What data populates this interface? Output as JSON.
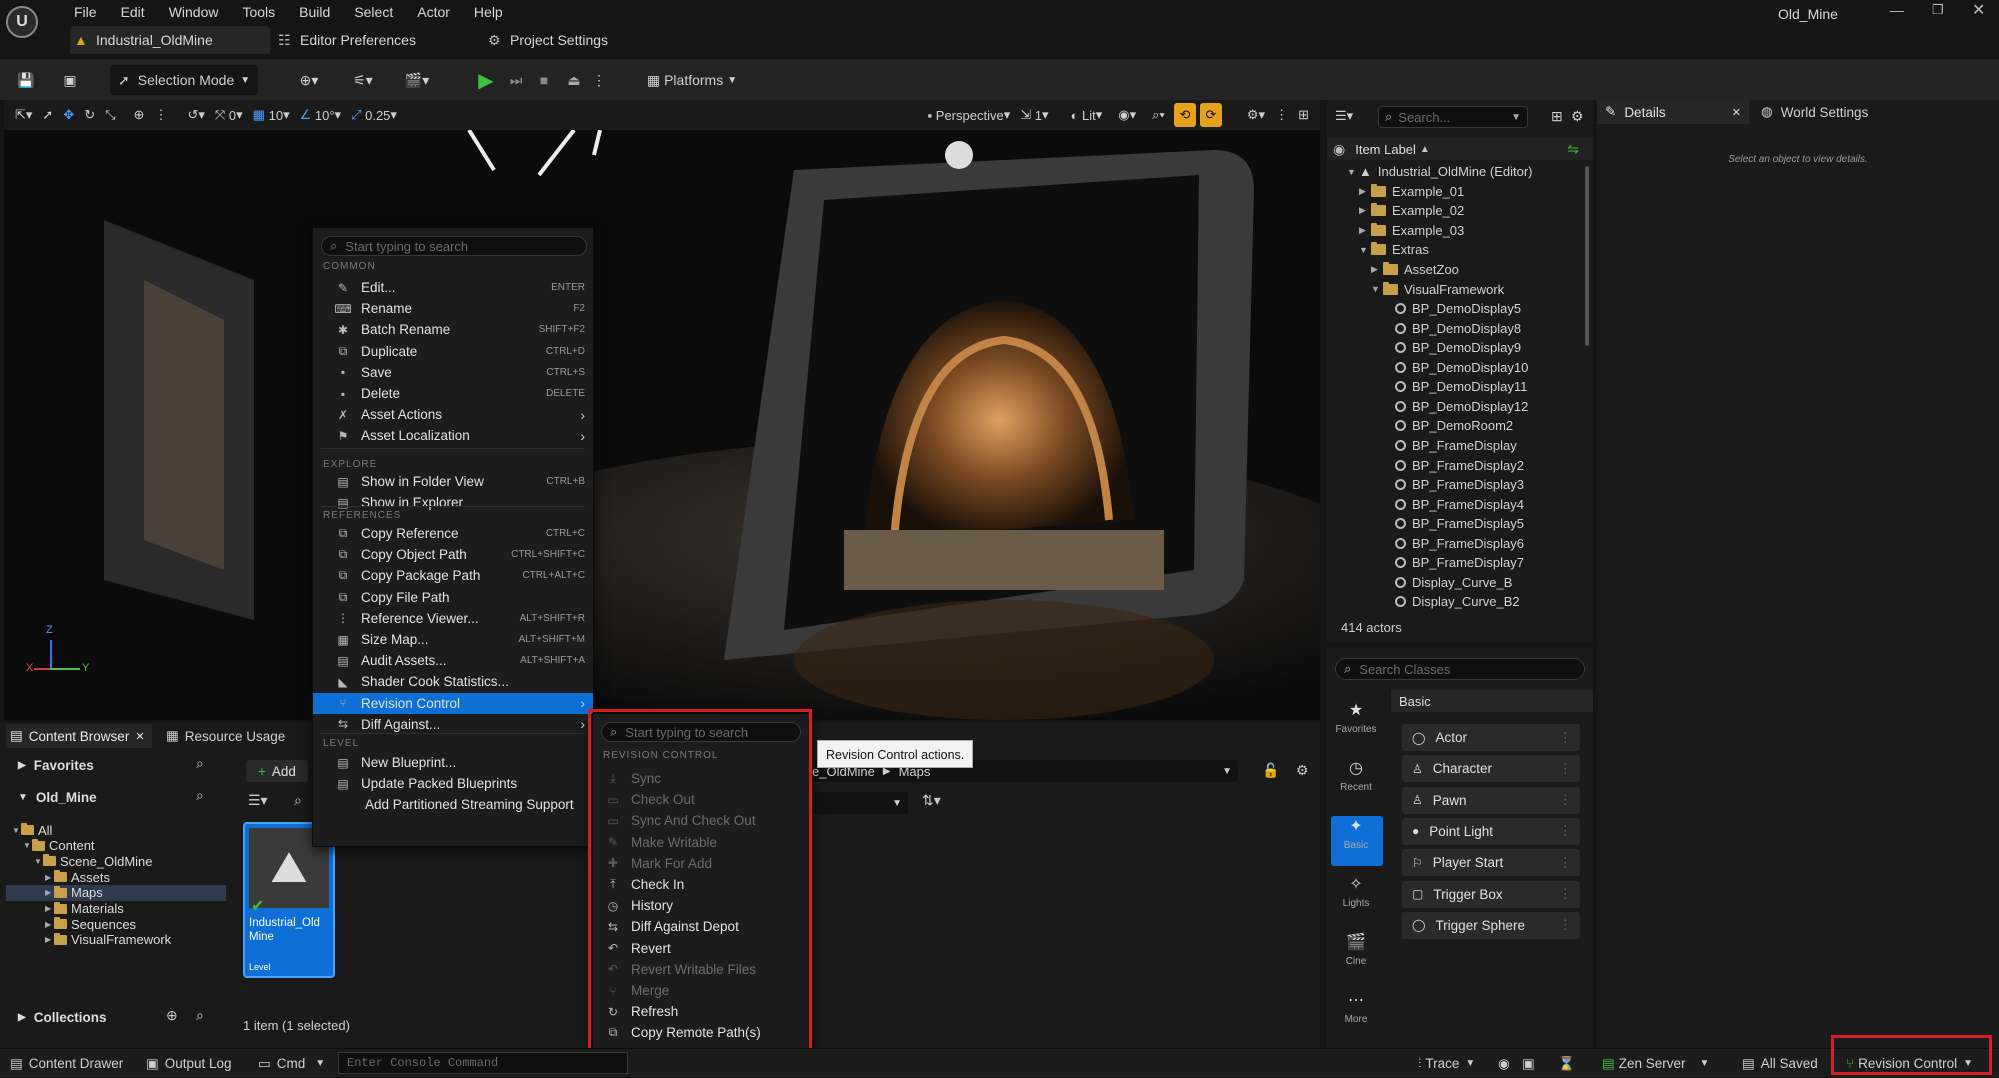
{
  "app": {
    "window_title": "Old_Mine",
    "menu": [
      "File",
      "Edit",
      "Window",
      "Tools",
      "Build",
      "Select",
      "Actor",
      "Help"
    ],
    "tabs": [
      {
        "label": "Industrial_OldMine",
        "active": true
      },
      {
        "label": "Editor Preferences"
      },
      {
        "label": "Project Settings"
      }
    ]
  },
  "toolbar": {
    "selection_mode": "Selection Mode",
    "platforms": "Platforms"
  },
  "viewport": {
    "snap_rotation": "0",
    "grid_size": "10",
    "rotation_snap": "10°",
    "scale_snap": "0.25",
    "view_mode_perspective": "Perspective",
    "camera_speed": "1",
    "lit": "Lit",
    "axis_z": "Z",
    "axis_x": "X",
    "axis_y": "Y"
  },
  "context_menu": {
    "search_placeholder": "Start typing to search",
    "sections": {
      "common": "COMMON",
      "explore": "EXPLORE",
      "references": "REFERENCES",
      "level": "LEVEL"
    },
    "common": [
      {
        "label": "Edit...",
        "shortcut": "ENTER",
        "icon": "pencil-icon"
      },
      {
        "label": "Rename",
        "shortcut": "F2",
        "icon": "rename-icon"
      },
      {
        "label": "Batch Rename",
        "shortcut": "SHIFT+F2",
        "icon": "batch-rename-icon"
      },
      {
        "label": "Duplicate",
        "shortcut": "CTRL+D",
        "icon": "duplicate-icon"
      },
      {
        "label": "Save",
        "shortcut": "CTRL+S",
        "icon": "save-icon"
      },
      {
        "label": "Delete",
        "shortcut": "DELETE",
        "icon": "trash-icon"
      },
      {
        "label": "Asset Actions",
        "submenu": true,
        "icon": "wrench-icon"
      },
      {
        "label": "Asset Localization",
        "submenu": true,
        "icon": "flag-icon"
      }
    ],
    "explore": [
      {
        "label": "Show in Folder View",
        "shortcut": "CTRL+B",
        "icon": "folder-view-icon"
      },
      {
        "label": "Show in Explorer",
        "icon": "explorer-icon"
      }
    ],
    "references": [
      {
        "label": "Copy Reference",
        "shortcut": "CTRL+C",
        "icon": "copy-icon"
      },
      {
        "label": "Copy Object Path",
        "shortcut": "CTRL+SHIFT+C",
        "icon": "copy-icon"
      },
      {
        "label": "Copy Package Path",
        "shortcut": "CTRL+ALT+C",
        "icon": "copy-icon"
      },
      {
        "label": "Copy File Path",
        "icon": "copy-icon"
      },
      {
        "label": "Reference Viewer...",
        "shortcut": "ALT+SHIFT+R",
        "icon": "reference-viewer-icon"
      },
      {
        "label": "Size Map...",
        "shortcut": "ALT+SHIFT+M",
        "icon": "size-map-icon"
      },
      {
        "label": "Audit Assets...",
        "shortcut": "ALT+SHIFT+A",
        "icon": "audit-icon"
      },
      {
        "label": "Shader Cook Statistics...",
        "icon": "shader-icon"
      },
      {
        "label": "Revision Control",
        "submenu": true,
        "highlighted": true,
        "icon": "revision-control-icon"
      },
      {
        "label": "Diff Against...",
        "submenu": true,
        "icon": "diff-icon"
      }
    ],
    "level": [
      {
        "label": "New Blueprint...",
        "icon": "blueprint-icon"
      },
      {
        "label": "Update Packed Blueprints",
        "icon": "blueprint-icon"
      },
      {
        "label": "Add Partitioned Streaming Support"
      }
    ]
  },
  "revision_submenu": {
    "search_placeholder": "Start typing to search",
    "section": "REVISION CONTROL",
    "items": [
      {
        "label": "Sync",
        "enabled": false,
        "icon": "sync-icon"
      },
      {
        "label": "Check Out",
        "enabled": false,
        "icon": "check-out-icon"
      },
      {
        "label": "Sync And Check Out",
        "enabled": false,
        "icon": "sync-check-out-icon"
      },
      {
        "label": "Make Writable",
        "enabled": false,
        "icon": "pencil-icon"
      },
      {
        "label": "Mark For Add",
        "enabled": false,
        "icon": "mark-add-icon"
      },
      {
        "label": "Check In",
        "enabled": true,
        "icon": "check-in-icon"
      },
      {
        "label": "History",
        "enabled": true,
        "icon": "history-icon"
      },
      {
        "label": "Diff Against Depot",
        "enabled": true,
        "icon": "diff-icon"
      },
      {
        "label": "Revert",
        "enabled": true,
        "icon": "revert-icon"
      },
      {
        "label": "Revert Writable Files",
        "enabled": false,
        "icon": "revert-icon"
      },
      {
        "label": "Merge",
        "enabled": false,
        "icon": "merge-icon"
      },
      {
        "label": "Refresh",
        "enabled": true,
        "icon": "refresh-icon"
      },
      {
        "label": "Copy Remote Path(s)",
        "enabled": true,
        "icon": "copy-icon"
      }
    ],
    "tooltip": "Revision Control actions."
  },
  "outliner": {
    "search_placeholder": "Search...",
    "column": "Item Label",
    "items": [
      {
        "label": "Industrial_OldMine (Editor)",
        "indent": 1,
        "type": "level",
        "expanded": true
      },
      {
        "label": "Example_01",
        "indent": 2,
        "type": "folder"
      },
      {
        "label": "Example_02",
        "indent": 2,
        "type": "folder"
      },
      {
        "label": "Example_03",
        "indent": 2,
        "type": "folder"
      },
      {
        "label": "Extras",
        "indent": 2,
        "type": "folder",
        "expanded": true
      },
      {
        "label": "AssetZoo",
        "indent": 3,
        "type": "folder"
      },
      {
        "label": "VisualFramework",
        "indent": 3,
        "type": "folder",
        "expanded": true
      },
      {
        "label": "BP_DemoDisplay5",
        "indent": 4,
        "type": "bp"
      },
      {
        "label": "BP_DemoDisplay8",
        "indent": 4,
        "type": "bp"
      },
      {
        "label": "BP_DemoDisplay9",
        "indent": 4,
        "type": "bp"
      },
      {
        "label": "BP_DemoDisplay10",
        "indent": 4,
        "type": "bp"
      },
      {
        "label": "BP_DemoDisplay11",
        "indent": 4,
        "type": "bp"
      },
      {
        "label": "BP_DemoDisplay12",
        "indent": 4,
        "type": "bp"
      },
      {
        "label": "BP_DemoRoom2",
        "indent": 4,
        "type": "bp"
      },
      {
        "label": "BP_FrameDisplay",
        "indent": 4,
        "type": "bp"
      },
      {
        "label": "BP_FrameDisplay2",
        "indent": 4,
        "type": "bp"
      },
      {
        "label": "BP_FrameDisplay3",
        "indent": 4,
        "type": "bp"
      },
      {
        "label": "BP_FrameDisplay4",
        "indent": 4,
        "type": "bp"
      },
      {
        "label": "BP_FrameDisplay5",
        "indent": 4,
        "type": "bp"
      },
      {
        "label": "BP_FrameDisplay6",
        "indent": 4,
        "type": "bp"
      },
      {
        "label": "BP_FrameDisplay7",
        "indent": 4,
        "type": "bp"
      },
      {
        "label": "Display_Curve_B",
        "indent": 4,
        "type": "mesh"
      },
      {
        "label": "Display_Curve_B2",
        "indent": 4,
        "type": "mesh"
      }
    ],
    "actor_count": "414 actors"
  },
  "place_actors": {
    "search_placeholder": "Search Classes",
    "category_title": "Basic",
    "categories": [
      "Favorites",
      "Recent",
      "Basic",
      "Lights",
      "Cine",
      "More"
    ],
    "items": [
      "Actor",
      "Character",
      "Pawn",
      "Point Light",
      "Player Start",
      "Trigger Box",
      "Trigger Sphere"
    ]
  },
  "details": {
    "tab": "Details",
    "tab2": "World Settings",
    "empty_text": "Select an object to view details."
  },
  "content_browser": {
    "tab": "Content Browser",
    "tab2": "Resource Usage",
    "favorites": "Favorites",
    "project": "Old_Mine",
    "add": "Add",
    "path_part1": "e_OldMine",
    "path_part2": "Maps",
    "tree": [
      {
        "label": "All",
        "indent": 0
      },
      {
        "label": "Content",
        "indent": 1
      },
      {
        "label": "Scene_OldMine",
        "indent": 2
      },
      {
        "label": "Assets",
        "indent": 3
      },
      {
        "label": "Maps",
        "indent": 3,
        "selected": true
      },
      {
        "label": "Materials",
        "indent": 3
      },
      {
        "label": "Sequences",
        "indent": 3
      },
      {
        "label": "VisualFramework",
        "indent": 3
      }
    ],
    "asset_name": "Industrial_Old Mine",
    "asset_type": "Level",
    "collections": "Collections",
    "status": "1 item (1 selected)"
  },
  "statusbar": {
    "content_drawer": "Content Drawer",
    "output_log": "Output Log",
    "cmd": "Cmd",
    "console_placeholder": "Enter Console Command",
    "trace": "Trace",
    "zen": "Zen Server",
    "saved": "All Saved",
    "revision": "Revision Control"
  },
  "colors": {
    "accent": "#0e6fd6",
    "highlight_red": "#d22020",
    "play_green": "#3cc03c",
    "orange_toggle": "#e6a21a"
  }
}
